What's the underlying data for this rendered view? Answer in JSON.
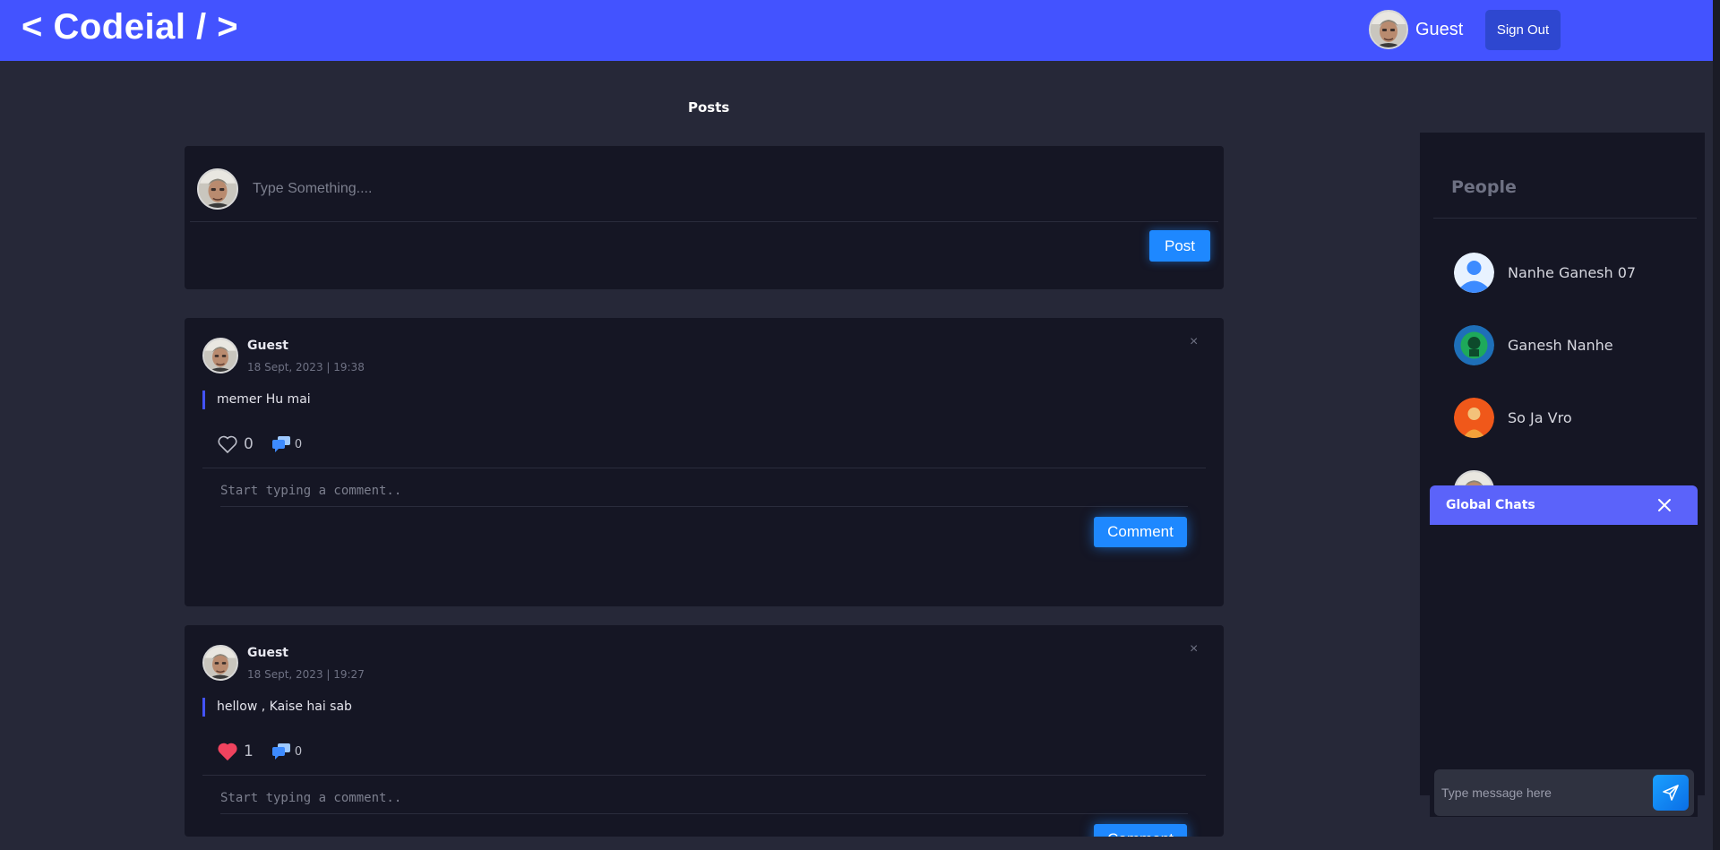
{
  "header": {
    "logo": "< Codeial / >",
    "user_name": "Guest",
    "signout_label": "Sign Out"
  },
  "main": {
    "posts_title": "Posts",
    "composer": {
      "placeholder": "Type Something....",
      "post_label": "Post"
    },
    "posts": [
      {
        "author": "Guest",
        "time": "18 Sept, 2023 | 19:38",
        "content": "memer Hu mai",
        "likes": "0",
        "liked": false,
        "comments": "0",
        "comment_placeholder": "Start typing a comment..",
        "comment_label": "Comment",
        "close": "×"
      },
      {
        "author": "Guest",
        "time": "18 Sept, 2023 | 19:27",
        "content": "hellow , Kaise hai sab",
        "likes": "1",
        "liked": true,
        "comments": "0",
        "comment_placeholder": "Start typing a comment..",
        "comment_label": "Comment",
        "close": "×"
      }
    ]
  },
  "people": {
    "title": "People",
    "items": [
      {
        "name": "Nanhe Ganesh 07",
        "avatar": "default-user-icon"
      },
      {
        "name": "Ganesh Nanhe",
        "avatar": "green-avatar"
      },
      {
        "name": "So Ja Vro",
        "avatar": "orange-avatar"
      },
      {
        "name": "",
        "avatar": "photo-avatar"
      }
    ]
  },
  "chat": {
    "title": "Global Chats",
    "placeholder": "Type message here"
  },
  "colors": {
    "header": "#4353ff",
    "background": "#262838",
    "card": "#151624",
    "button": "#1e88ff",
    "chat_header": "#5b63fa",
    "like": "#f0435e"
  }
}
